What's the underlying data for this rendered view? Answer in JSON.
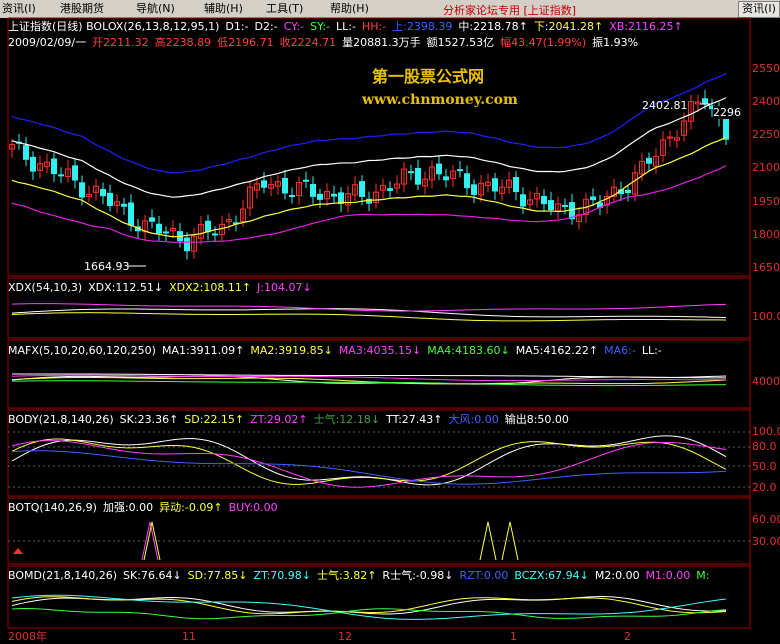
{
  "menu": {
    "items": [
      "资讯(I)",
      "港股期货",
      "导航(N)",
      "辅助(H)",
      "工具(T)",
      "帮助(H)"
    ],
    "title": "分析家论坛专用 [上证指数]",
    "right_button": "资讯(I)"
  },
  "main_panel": {
    "title_segments": [
      {
        "text": "上证指数(日线) BOLOX(26,13,8,12,95,1)",
        "color": "#ffffff"
      },
      {
        "text": "D1:-",
        "color": "#ffffff"
      },
      {
        "text": "D2:-",
        "color": "#ffffff"
      },
      {
        "text": "CY:-",
        "color": "#ff40ff"
      },
      {
        "text": "SY:-",
        "color": "#40ff40"
      },
      {
        "text": "LL:-",
        "color": "#ffffff"
      },
      {
        "text": "HH:-",
        "color": "#ff4040"
      },
      {
        "text": "上:2398.39",
        "color": "#4060ff"
      },
      {
        "text": "中:2218.78↑",
        "color": "#ffffff"
      },
      {
        "text": "下:2041.28↑",
        "color": "#ffff40"
      },
      {
        "text": "XB:2116.25↑",
        "color": "#ff40ff"
      }
    ],
    "info_segments": [
      {
        "text": "2009/02/09/一",
        "color": "#ffffff"
      },
      {
        "text": "开2211.32",
        "color": "#ff4040"
      },
      {
        "text": "高2238.89",
        "color": "#ff4040"
      },
      {
        "text": "低2196.71",
        "color": "#ff4040"
      },
      {
        "text": "收2224.71",
        "color": "#ff4040"
      },
      {
        "text": "量20881.3万手",
        "color": "#ffffff"
      },
      {
        "text": "额1527.53亿",
        "color": "#ffffff"
      },
      {
        "text": "幅43.47(1.99%)",
        "color": "#ff4040"
      },
      {
        "text": "振1.93%",
        "color": "#ffffff"
      }
    ],
    "watermark_cn": "第一股票公式网",
    "watermark_url": "www.chnmoney.com",
    "high_label": "2402.81",
    "low_label": "1664.93",
    "last_label": "2296",
    "axis": [
      "2550",
      "2400",
      "2250",
      "2100",
      "1950",
      "1800",
      "1650"
    ]
  },
  "xdx": {
    "segments": [
      {
        "text": "XDX(54,10,3)",
        "color": "#ffffff"
      },
      {
        "text": "XDX:112.51↓",
        "color": "#ffffff"
      },
      {
        "text": "XDX2:108.11↑",
        "color": "#ffff40"
      },
      {
        "text": "J:104.07↓",
        "color": "#ff40ff"
      }
    ],
    "axis": [
      "100.0"
    ]
  },
  "mafx": {
    "segments": [
      {
        "text": "MAFX(5,10,20,60,120,250)",
        "color": "#ffffff"
      },
      {
        "text": "MA1:3911.09↑",
        "color": "#ffffff"
      },
      {
        "text": "MA2:3919.85↓",
        "color": "#ffff40"
      },
      {
        "text": "MA3:4035.15↓",
        "color": "#ff40ff"
      },
      {
        "text": "MA4:4183.60↓",
        "color": "#40ff40"
      },
      {
        "text": "MA5:4162.22↑",
        "color": "#ffffff"
      },
      {
        "text": "MA6:-",
        "color": "#4060ff"
      },
      {
        "text": "LL:-",
        "color": "#ffffff"
      }
    ],
    "axis": [
      "4000"
    ]
  },
  "body_ind": {
    "segments": [
      {
        "text": "BODY(21,8,140,26)",
        "color": "#ffffff"
      },
      {
        "text": "SK:23.36↑",
        "color": "#ffffff"
      },
      {
        "text": "SD:22.15↑",
        "color": "#ffff40"
      },
      {
        "text": "ZT:29.02↑",
        "color": "#ff40ff"
      },
      {
        "text": "士气:12.18↓",
        "color": "#40a040"
      },
      {
        "text": "TT:27.43↑",
        "color": "#ffffff"
      },
      {
        "text": "大风:0.00",
        "color": "#4060ff"
      },
      {
        "text": "输出8:50.00",
        "color": "#ffffff"
      }
    ],
    "axis": [
      "100.0",
      "80.0",
      "50.0",
      "20.0"
    ]
  },
  "botq": {
    "segments": [
      {
        "text": "BOTQ(140,26,9)",
        "color": "#ffffff"
      },
      {
        "text": "加强:0.00",
        "color": "#ffffff"
      },
      {
        "text": "异动:-0.09↑",
        "color": "#ffff40"
      },
      {
        "text": "BUY:0.00",
        "color": "#ff40ff"
      }
    ],
    "axis": [
      "60.00",
      "30.00"
    ]
  },
  "bomd": {
    "segments": [
      {
        "text": "BOMD(21,8,140,26)",
        "color": "#ffffff"
      },
      {
        "text": "SK:76.64↓",
        "color": "#ffffff"
      },
      {
        "text": "SD:77.85↓",
        "color": "#ffff40"
      },
      {
        "text": "ZT:70.98↓",
        "color": "#40ffff"
      },
      {
        "text": "士气:3.82↑",
        "color": "#ffff40"
      },
      {
        "text": "R士气:-0.98↓",
        "color": "#ffffff"
      },
      {
        "text": "RZT:0.00",
        "color": "#4060ff"
      },
      {
        "text": "BCZX:67.94↓",
        "color": "#40ffff"
      },
      {
        "text": "M2:0.00",
        "color": "#ffffff"
      },
      {
        "text": "M1:0.00",
        "color": "#ff40ff"
      },
      {
        "text": "M:",
        "color": "#40ff40"
      }
    ]
  },
  "date_axis": [
    "2008年",
    "11",
    "12",
    "1",
    "2"
  ],
  "colors": {
    "up_candle": "#ff3030",
    "down_candle": "#30f0f0",
    "border": "#a00000",
    "upper_band": "#2020ff",
    "mid_band": "#ffffff",
    "low_band": "#ffff40",
    "xb": "#e020e0"
  }
}
